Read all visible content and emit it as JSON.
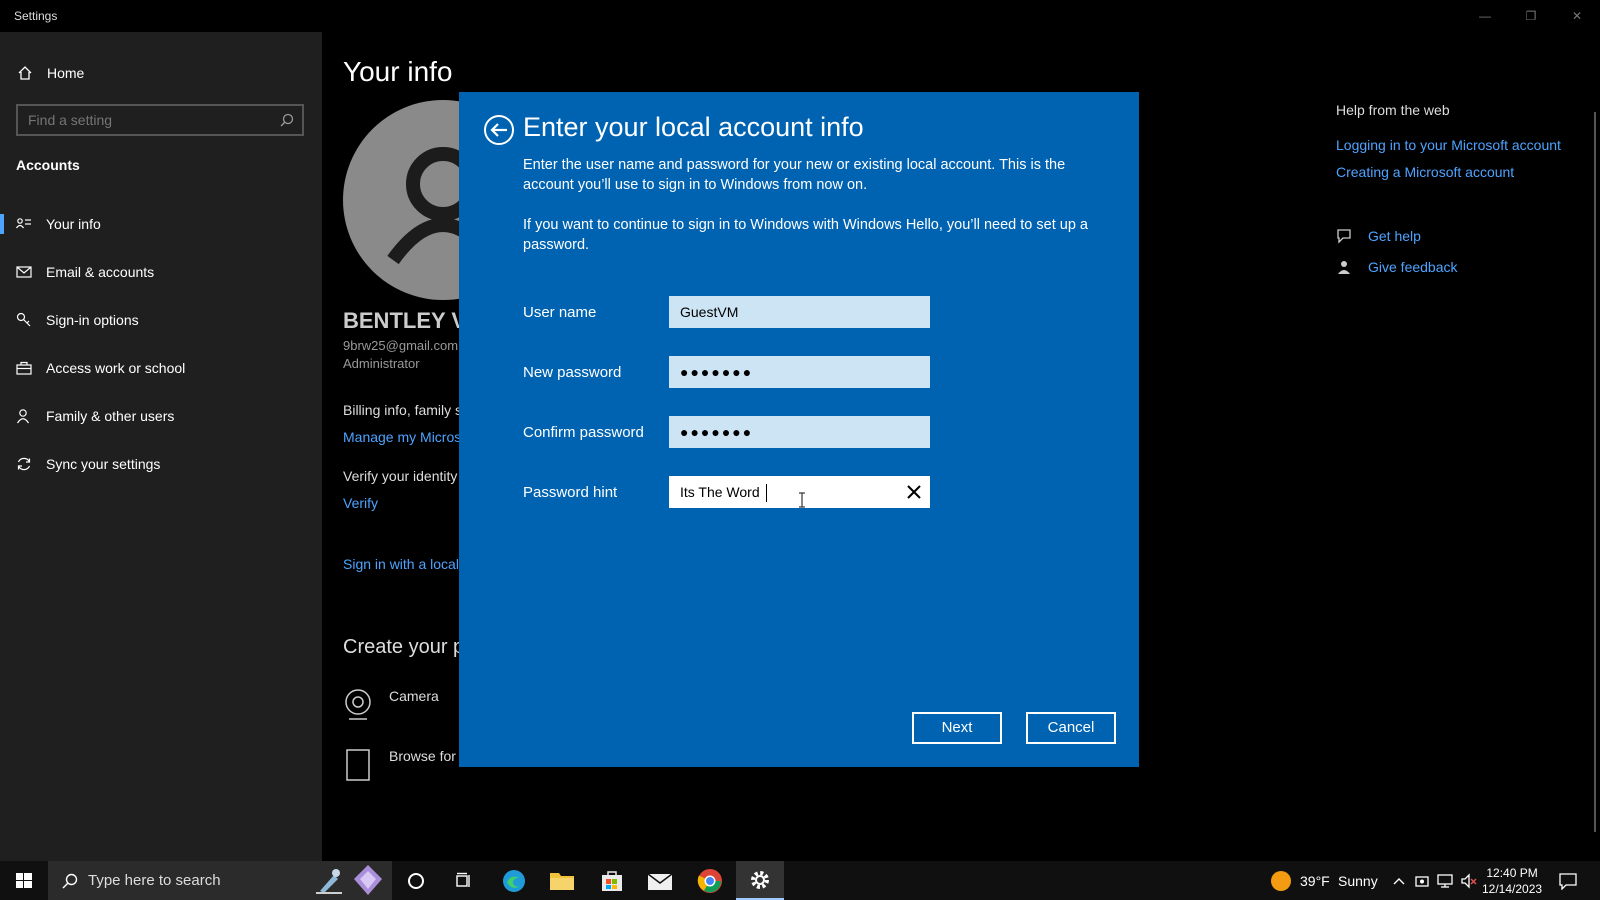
{
  "window": {
    "title": "Settings",
    "minimize": "—",
    "restore": "❐",
    "close": "✕"
  },
  "sidebar": {
    "home_label": "Home",
    "search_placeholder": "Find a setting",
    "section_title": "Accounts",
    "items": [
      {
        "label": "Your info",
        "icon": "person-card-icon"
      },
      {
        "label": "Email & accounts",
        "icon": "mail-icon"
      },
      {
        "label": "Sign-in options",
        "icon": "key-icon"
      },
      {
        "label": "Access work or school",
        "icon": "briefcase-icon"
      },
      {
        "label": "Family & other users",
        "icon": "person-icon"
      },
      {
        "label": "Sync your settings",
        "icon": "sync-icon"
      }
    ]
  },
  "main": {
    "page_title": "Your info",
    "user_name": "BENTLEY V",
    "user_email": "9brw25@gmail.com",
    "user_role": "Administrator",
    "billing_text": "Billing info, family s",
    "manage_link": "Manage my Micros",
    "verify_text": "Verify your identity",
    "verify_link": "Verify",
    "signin_local_link": "Sign in with a local",
    "create_title": "Create your p",
    "camera_label": "Camera",
    "browse_label": "Browse for"
  },
  "help": {
    "title": "Help from the web",
    "links": [
      "Logging in to your Microsoft account",
      "Creating a Microsoft account"
    ],
    "get_help": "Get help",
    "give_feedback": "Give feedback"
  },
  "dialog": {
    "title": "Enter your local account info",
    "para1": "Enter the user name and password for your new or existing local account. This is the account you’ll use to sign in to Windows from now on.",
    "para2": "If you want to continue to sign in to Windows with Windows Hello, you’ll need to set up a password.",
    "username_label": "User name",
    "username_value": "GuestVM",
    "new_password_label": "New password",
    "new_password_value": "●●●●●●●",
    "confirm_password_label": "Confirm password",
    "confirm_password_value": "●●●●●●●",
    "hint_label": "Password hint",
    "hint_value": "Its The Word",
    "next_label": "Next",
    "cancel_label": "Cancel"
  },
  "taskbar": {
    "search_placeholder": "Type here to search",
    "weather_temp": "39°F",
    "weather_text": "Sunny",
    "time": "12:40 PM",
    "date": "12/14/2023"
  },
  "colors": {
    "dialog_bg": "#0063b1",
    "accent_link": "#4ea3ff",
    "sidebar_bg": "#1f1f1f"
  }
}
